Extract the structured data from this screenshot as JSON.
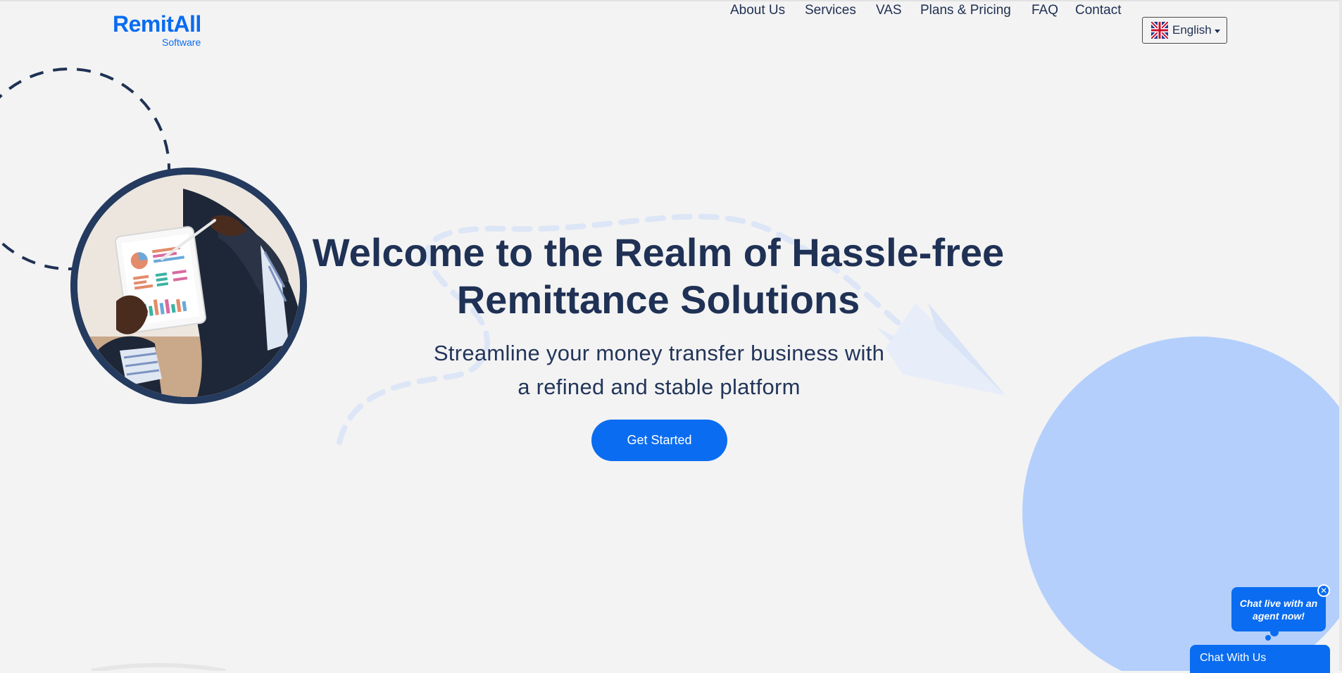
{
  "brand": {
    "name": "RemitAll",
    "tagline": "Software",
    "accent_color": "#0a6cf0",
    "heading_color": "#1f3154"
  },
  "nav": {
    "items": [
      {
        "label": "About Us"
      },
      {
        "label": "Services"
      },
      {
        "label": "VAS"
      },
      {
        "label": "Plans & Pricing"
      },
      {
        "label": "FAQ"
      },
      {
        "label": "Contact"
      }
    ],
    "language": {
      "label": "English",
      "icon": "uk-flag-icon"
    }
  },
  "hero": {
    "title_line1": "Welcome to the Realm of Hassle-free",
    "title_line2": "Remittance Solutions",
    "subtitle_line1": "Streamline your money transfer business with",
    "subtitle_line2": "a refined and stable platform",
    "cta_label": "Get Started",
    "image_icon": "tablet-analytics-photo"
  },
  "chat": {
    "bubble_line1": "Chat live with an",
    "bubble_line2": "agent now!",
    "close_icon": "close-icon",
    "button_label": "Chat With Us"
  }
}
